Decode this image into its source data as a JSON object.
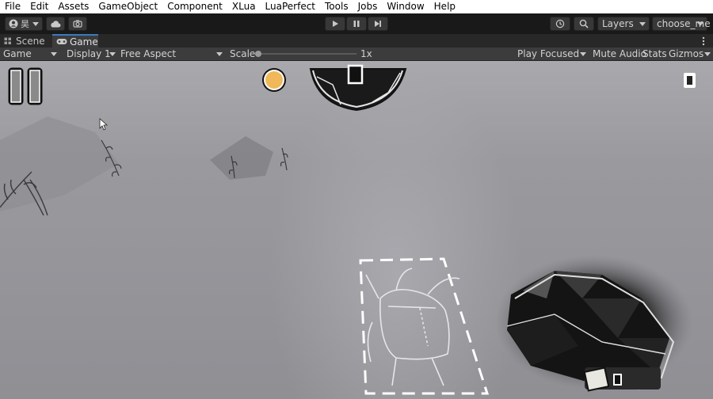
{
  "menu": [
    "File",
    "Edit",
    "Assets",
    "GameObject",
    "Component",
    "XLua",
    "LuaPerfect",
    "Tools",
    "Jobs",
    "Window",
    "Help"
  ],
  "toolbar": {
    "account_glyph": "昊",
    "layers_label": "Layers",
    "layout_label": "choose_me"
  },
  "tabs": [
    {
      "label": "Scene"
    },
    {
      "label": "Game"
    }
  ],
  "gamebar": {
    "view_mode": "Game",
    "display": "Display 1",
    "aspect": "Free Aspect",
    "scale_label": "Scale",
    "scale_value": "1x",
    "play_focused": "Play Focused",
    "mute_audio": "Mute Audio",
    "stats": "Stats",
    "gizmos": "Gizmos"
  },
  "colors": {
    "menubar_bg": "#ffffff",
    "toolbar_bg": "#191919",
    "tab_active_accent": "#3a79bb",
    "coin": "#f0b85a"
  },
  "icons": [
    "account-icon",
    "cloud-icon",
    "collab-icon",
    "play-icon",
    "pause-icon",
    "step-icon",
    "history-icon",
    "search-icon",
    "game-tab-icon",
    "scene-tab-icon",
    "more-icon",
    "pause-game-icon",
    "coin-icon",
    "card-icon"
  ]
}
